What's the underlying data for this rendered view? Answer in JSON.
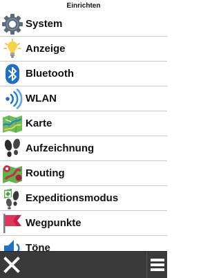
{
  "header": {
    "title": "Einrichten"
  },
  "menu": {
    "items": [
      {
        "label": "System",
        "icon": "gear-icon"
      },
      {
        "label": "Anzeige",
        "icon": "lightbulb-icon"
      },
      {
        "label": "Bluetooth",
        "icon": "bluetooth-icon"
      },
      {
        "label": "WLAN",
        "icon": "wifi-icon"
      },
      {
        "label": "Karte",
        "icon": "map-icon"
      },
      {
        "label": "Aufzeichnung",
        "icon": "footprints-icon"
      },
      {
        "label": "Routing",
        "icon": "routing-icon"
      },
      {
        "label": "Expeditionsmodus",
        "icon": "expedition-icon"
      },
      {
        "label": "Wegpunkte",
        "icon": "flag-icon"
      },
      {
        "label": "Töne",
        "icon": "sound-icon"
      }
    ]
  },
  "bottom_bar": {
    "close_icon": "close-icon",
    "menu_icon": "hamburger-menu-icon"
  },
  "colors": {
    "background": "#ffffff",
    "bottom_bar": "#3a3a3a",
    "divider": "#c9c9c9",
    "text": "#111111"
  }
}
